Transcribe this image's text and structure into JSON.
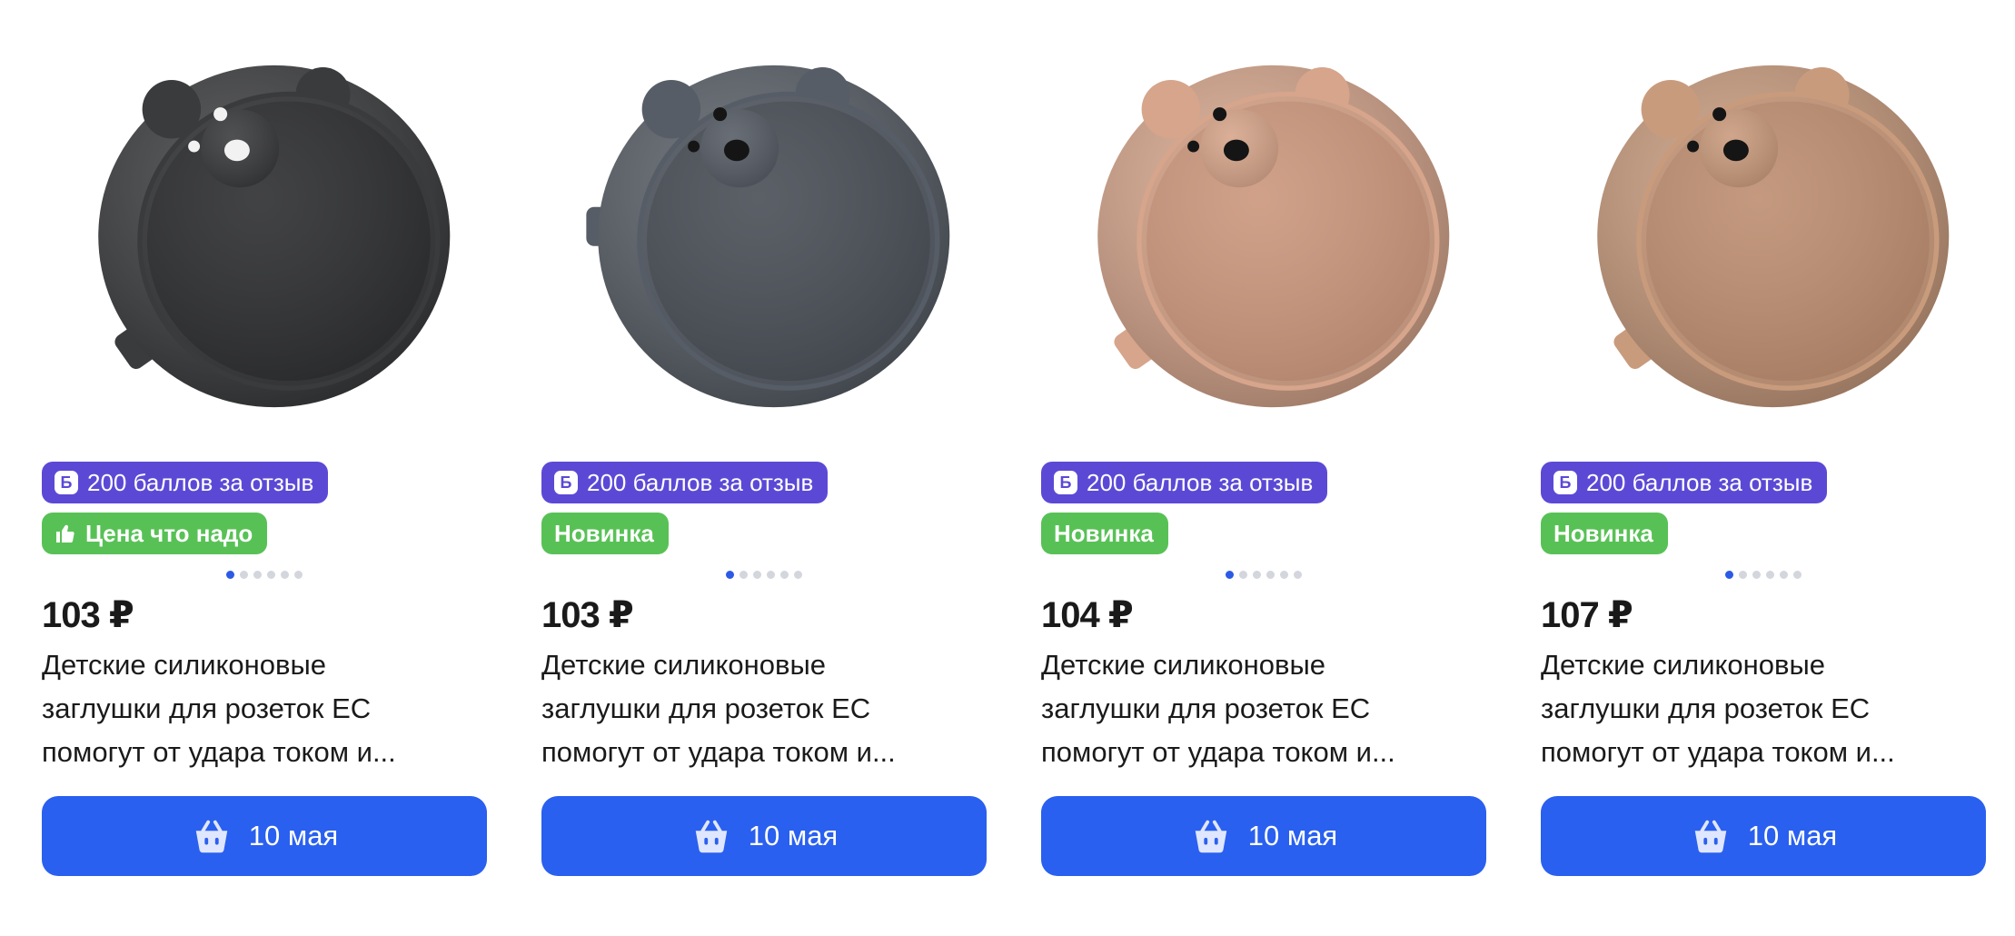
{
  "products": [
    {
      "badge_points": "200 баллов за отзыв",
      "badge_points_icon": "Б",
      "badge_tag": "Цена что надо",
      "badge_tag_icon": "thumbs-up-icon",
      "price": "103 ₽",
      "title_lines": [
        "Детские силиконовые",
        "заглушки для розеток ЕС",
        "помогут от удара током и..."
      ],
      "button_label": "10 мая",
      "image_color": "#3a3b3d",
      "image_inner": "#2f3032",
      "dot_count": 6,
      "active_dot": 0
    },
    {
      "badge_points": "200 баллов за отзыв",
      "badge_points_icon": "Б",
      "badge_tag": "Новинка",
      "price": "103 ₽",
      "title_lines": [
        "Детские силиконовые",
        "заглушки для розеток ЕС",
        "помогут от удара током и..."
      ],
      "button_label": "10 мая",
      "image_color": "#575d66",
      "image_inner": "#4b5058",
      "dot_count": 6,
      "active_dot": 0
    },
    {
      "badge_points": "200 баллов за отзыв",
      "badge_points_icon": "Б",
      "badge_tag": "Новинка",
      "price": "104 ₽",
      "title_lines": [
        "Детские силиконовые",
        "заглушки для розеток ЕС",
        "помогут от удара током и..."
      ],
      "button_label": "10 мая",
      "image_color": "#d6a58b",
      "image_inner": "#cc987e",
      "dot_count": 6,
      "active_dot": 0
    },
    {
      "badge_points": "200 баллов за отзыв",
      "badge_points_icon": "Б",
      "badge_tag": "Новинка",
      "price": "107 ₽",
      "title_lines": [
        "Детские силиконовые",
        "заглушки для розеток ЕС",
        "помогут от удара током и..."
      ],
      "button_label": "10 мая",
      "image_color": "#c99b7d",
      "image_inner": "#be8f72",
      "dot_count": 6,
      "active_dot": 0
    }
  ],
  "colors": {
    "points_badge": "#5b49d6",
    "tag_badge": "#58c156",
    "button": "#2a60ef"
  },
  "icons": {
    "cart": "basket-icon"
  }
}
